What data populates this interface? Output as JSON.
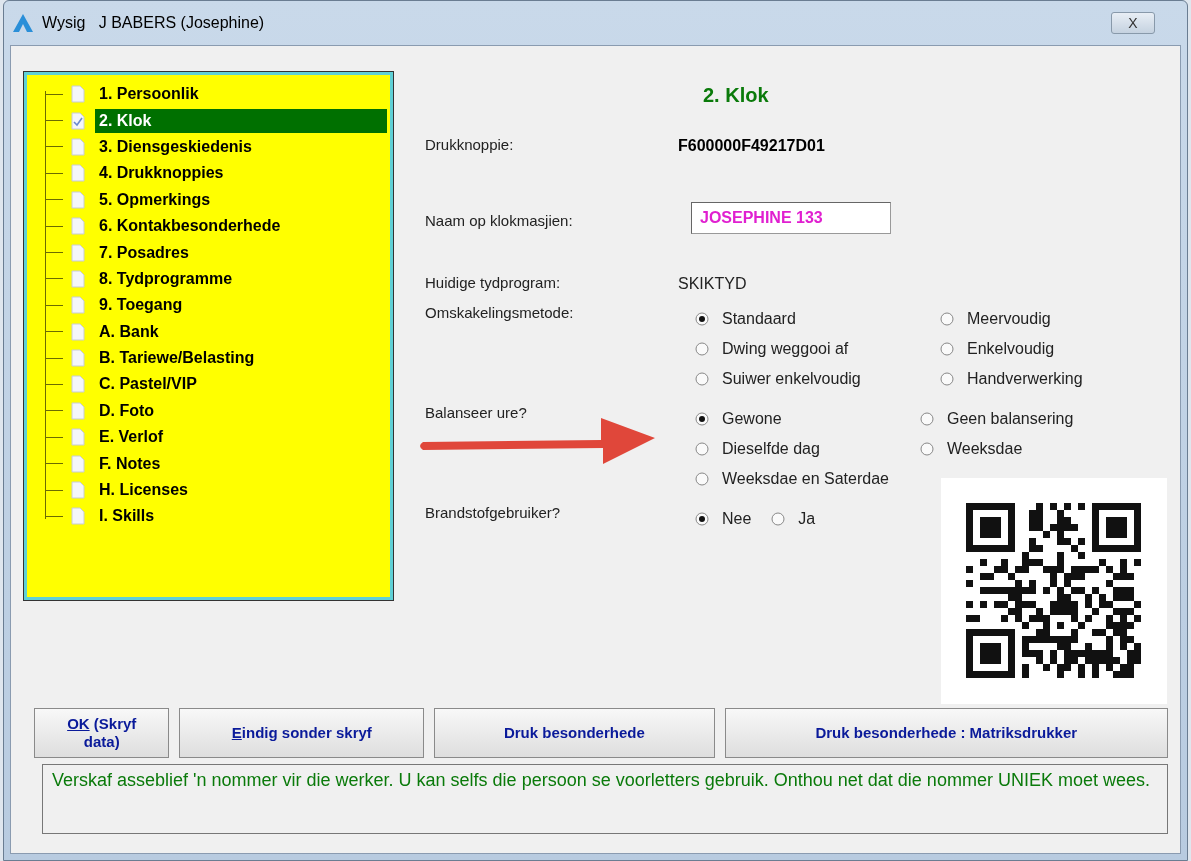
{
  "window": {
    "title": "Wysig   J BABERS (Josephine)",
    "close": "X"
  },
  "tree": {
    "items": [
      {
        "label": "1. Persoonlik",
        "selected": false
      },
      {
        "label": "2. Klok",
        "selected": true
      },
      {
        "label": "3. Diensgeskiedenis",
        "selected": false
      },
      {
        "label": "4. Drukknoppies",
        "selected": false
      },
      {
        "label": "5. Opmerkings",
        "selected": false
      },
      {
        "label": "6. Kontakbesonderhede",
        "selected": false
      },
      {
        "label": "7. Posadres",
        "selected": false
      },
      {
        "label": "8. Tydprogramme",
        "selected": false
      },
      {
        "label": "9. Toegang",
        "selected": false
      },
      {
        "label": "A. Bank",
        "selected": false
      },
      {
        "label": "B. Tariewe/Belasting",
        "selected": false
      },
      {
        "label": "C. Pastel/VIP",
        "selected": false
      },
      {
        "label": "D. Foto",
        "selected": false
      },
      {
        "label": "E. Verlof",
        "selected": false
      },
      {
        "label": "F. Notes",
        "selected": false
      },
      {
        "label": "H. Licenses",
        "selected": false
      },
      {
        "label": "I. Skills",
        "selected": false
      }
    ]
  },
  "panel": {
    "heading": "2. Klok",
    "fields": [
      {
        "kind": "bold",
        "label": "Drukknoppie:",
        "value": "F600000F49217D01"
      },
      {
        "kind": "input",
        "label": "Naam op klokmasjien:",
        "value": "JOSEPHINE 133"
      },
      {
        "kind": "plain",
        "label": "Huidige tydprogram:",
        "value": "SKIKTYD"
      }
    ],
    "radio_groups": [
      {
        "kind": "grid",
        "label": "Omskakelingsmetode:",
        "options": [
          {
            "label": "Standaard",
            "selected": true
          },
          {
            "label": "Meervoudig",
            "selected": false
          },
          {
            "label": "Dwing weggooi af",
            "selected": false
          },
          {
            "label": "Enkelvoudig",
            "selected": false
          },
          {
            "label": "Suiwer enkelvoudig",
            "selected": false
          },
          {
            "label": "Handverwerking",
            "selected": false
          }
        ]
      },
      {
        "kind": "grid",
        "label": "Balanseer ure?",
        "options": [
          {
            "label": "Gewone",
            "selected": true
          },
          {
            "label": "Geen balansering",
            "selected": false
          },
          {
            "label": "Dieselfde dag",
            "selected": false
          },
          {
            "label": "Weeksdae",
            "selected": false
          },
          {
            "label": "Weeksdae en Saterdae",
            "selected": false
          }
        ]
      },
      {
        "kind": "inline",
        "label": "Brandstofgebruiker?",
        "options": [
          {
            "label": "Nee",
            "selected": true
          },
          {
            "label": "Ja",
            "selected": false
          }
        ]
      }
    ]
  },
  "buttons": [
    {
      "access_key": "OK",
      "label": " (Skryf data)"
    },
    {
      "access_key": "E",
      "label": "indig sonder skryf"
    },
    {
      "label": "Druk besonderhede"
    },
    {
      "label": "Druk besonderhede : Matriksdrukker"
    }
  ],
  "message": "Verskaf asseblief 'n nommer vir die werker. U kan selfs die persoon se voorletters gebruik. Onthou net dat die nommer UNIEK moet wees."
}
